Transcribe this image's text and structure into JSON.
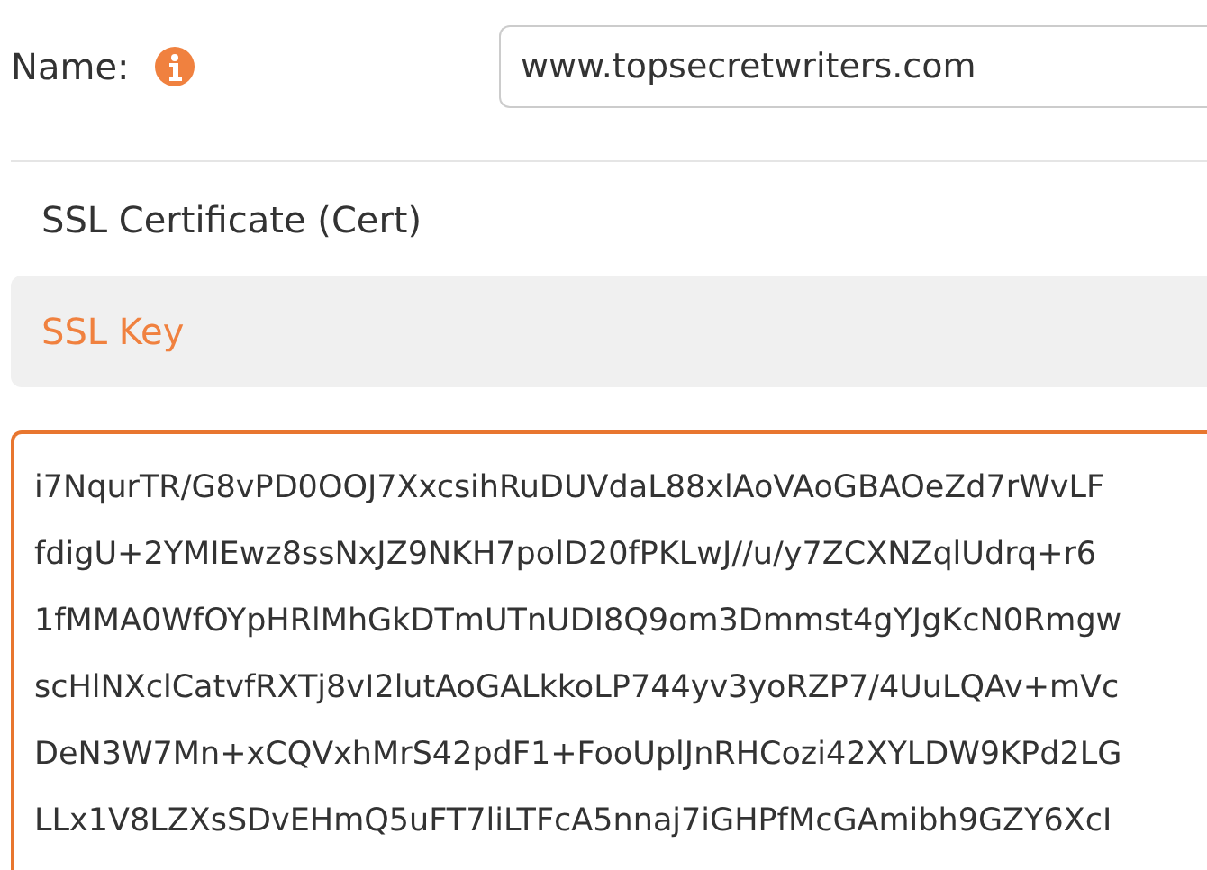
{
  "name_field": {
    "label": "Name:",
    "value": "www.topsecretwriters.com"
  },
  "tabs": [
    {
      "label": "SSL Certificate (Cert)",
      "selected": false
    },
    {
      "label": "SSL Key",
      "selected": true
    }
  ],
  "key_lines": [
    "i7NqurTR/G8vPD0OOJ7XxcsihRuDUVdaL88xlAoVAoGBAOeZd7rWvLF",
    "fdigU+2YMIEwz8ssNxJZ9NKH7polD20fPKLwJ//u/y7ZCXNZqlUdrq+r6",
    "1fMMA0WfOYpHRlMhGkDTmUTnUDI8Q9om3Dmmst4gYJgKcN0Rmgw",
    "scHlNXclCatvfRXTj8vI2lutAoGALkkoLP744yv3yoRZP7/4UuLQAv+mVc",
    "DeN3W7Mn+xCQVxhMrS42pdF1+FooUplJnRHCozi42XYLDW9KPd2LG",
    "LLx1V8LZXsSDvEHmQ5uFT7liLTFcA5nnaj7iGHPfMcGAmibh9GZY6XcI"
  ]
}
